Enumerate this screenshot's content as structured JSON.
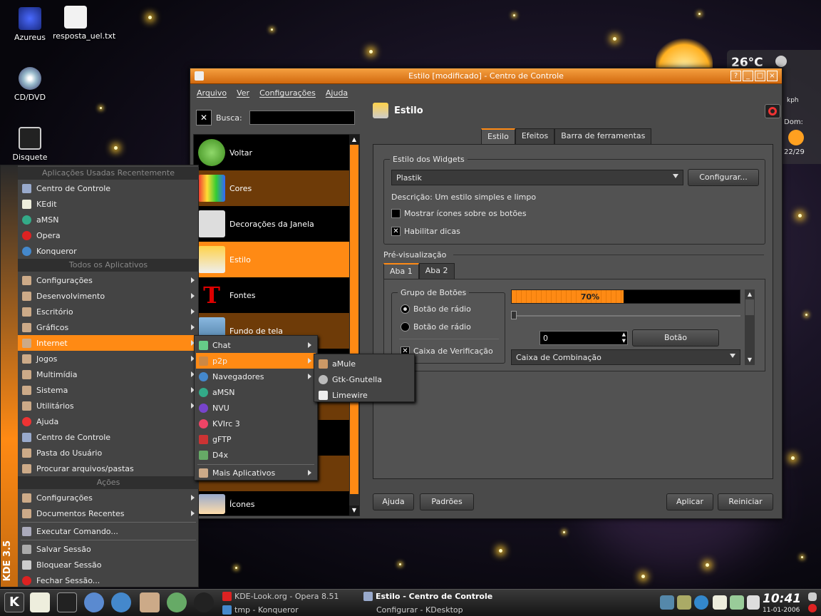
{
  "desktop": {
    "icons": [
      {
        "label": "Azureus"
      },
      {
        "label": "resposta_uel.txt"
      },
      {
        "label": "CD/DVD"
      },
      {
        "label": "Disquete"
      }
    ]
  },
  "weather": {
    "temperature": "26°C",
    "unit": "kph",
    "label": "Dom:",
    "date": "22/29"
  },
  "window": {
    "title": "Estilo [modificado] - Centro de Controle",
    "title_buttons": [
      "?",
      "_",
      "□",
      "×"
    ],
    "menu": [
      "Arquivo",
      "Ver",
      "Configurações",
      "Ajuda"
    ],
    "search_label": "Busca:",
    "modules": [
      {
        "label": "Voltar"
      },
      {
        "label": "Cores"
      },
      {
        "label": "Decorações da Janela"
      },
      {
        "label": "Estilo"
      },
      {
        "label": "Fontes"
      },
      {
        "label": "Fundo de tela"
      },
      {
        "label": "Ícones"
      }
    ],
    "module_title": "Estilo",
    "tabs": [
      "Estilo",
      "Efeitos",
      "Barra de ferramentas"
    ],
    "widget_group": {
      "title": "Estilo dos Widgets",
      "style_value": "Plastik",
      "configure_button": "Configurar...",
      "description": "Descrição: Um estilo simples e limpo",
      "show_icons_label": "Mostrar ícones sobre os botões",
      "show_icons_checked": false,
      "tooltips_label": "Habilitar dicas",
      "tooltips_checked": true
    },
    "preview": {
      "title": "Pré-visualização",
      "tabs": [
        "Aba 1",
        "Aba 2"
      ],
      "button_group_title": "Grupo de Botões",
      "radio1": "Botão de rádio",
      "radio2": "Botão de rádio",
      "checkbox": "Caixa de Verificação",
      "progress_percent": 70,
      "progress_label": "70%",
      "spin_value": "0",
      "button": "Botão",
      "combo": "Caixa de Combinação"
    },
    "footer": {
      "help": "Ajuda",
      "defaults": "Padrões",
      "apply": "Aplicar",
      "reset": "Reiniciar"
    }
  },
  "kmenu": {
    "side_label": "KDE 3.5",
    "recent_header": "Aplicações Usadas Recentemente",
    "recent": [
      "Centro de Controle",
      "KEdit",
      "aMSN",
      "Opera",
      "Konqueror"
    ],
    "all_header": "Todos os Aplicativos",
    "apps": [
      "Configurações",
      "Desenvolvimento",
      "Escritório",
      "Gráficos",
      "Internet",
      "Jogos",
      "Multimídia",
      "Sistema",
      "Utilitários"
    ],
    "extra": [
      "Ajuda",
      "Centro de Controle",
      "Pasta do Usuário",
      "Procurar arquivos/pastas"
    ],
    "actions_header": "Ações",
    "actions": [
      "Configurações",
      "Documentos Recentes",
      "Executar Comando...",
      "Salvar Sessão",
      "Bloquear Sessão",
      "Fechar Sessão..."
    ]
  },
  "internet_submenu": [
    "Chat",
    "p2p",
    "Navegadores",
    "aMSN",
    "NVU",
    "KVIrc 3",
    "gFTP",
    "D4x",
    "Mais Aplicativos"
  ],
  "p2p_submenu": [
    "aMule",
    "Gtk-Gnutella",
    "Limewire"
  ],
  "taskbar": {
    "tasks": [
      "KDE-Look.org - Opera 8.51",
      "tmp - Konqueror",
      "Estilo - Centro de Controle",
      "Configurar - KDesktop"
    ],
    "clock": "10:41",
    "date": "11-01-2006"
  },
  "colors": {
    "accent": "#ff8a14",
    "panel": "#4a4a4a"
  }
}
